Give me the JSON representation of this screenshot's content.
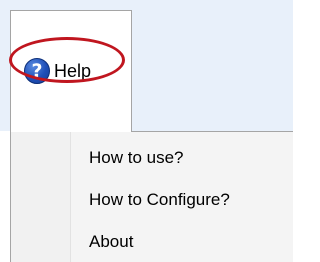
{
  "menubar": {
    "help": {
      "label": "Help",
      "icon": "help-question-icon",
      "icon_glyph": "?",
      "selected": true
    }
  },
  "dropdown": {
    "items": [
      {
        "label": "How to use?"
      },
      {
        "label": "How to Configure?"
      },
      {
        "label": "About"
      }
    ]
  },
  "annotation": {
    "shape": "ellipse",
    "color": "#c0161f"
  }
}
